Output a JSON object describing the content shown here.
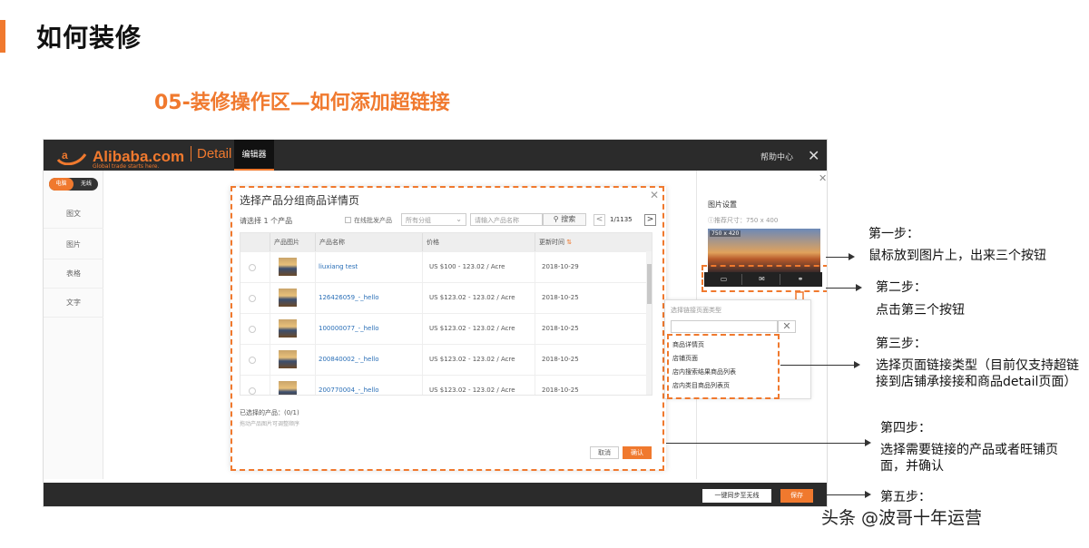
{
  "slide": {
    "title": "如何装修",
    "subtitle": "05-装修操作区—如何添加超链接"
  },
  "app": {
    "logo_text": "Alibaba.com",
    "logo_tagline": "Global trade starts here.",
    "detail": "Detail",
    "editor_tab": "编辑器",
    "help": "帮助中心",
    "close": "✕",
    "toggle": {
      "on": "电脑",
      "off": "无线"
    },
    "nav": [
      "图文",
      "图片",
      "表格",
      "文字"
    ]
  },
  "modal": {
    "title": "选择产品分组商品详情页",
    "close": "✕",
    "select_count": "请选择 1 个产品",
    "batch_label": "在线批发产品",
    "group_select": "所有分组",
    "search_placeholder": "请输入产品名称",
    "search_button": "搜索",
    "prev": "<",
    "next": ">",
    "page_text": "1/1135",
    "columns": [
      "产品图片",
      "产品名称",
      "价格",
      "更新时间"
    ],
    "rows": [
      {
        "name": "liuxiang test",
        "price": "US $100 - 123.02 / Acre",
        "date": "2018-10-29"
      },
      {
        "name": "126426059_-_hello",
        "price": "US $123.02 - 123.02 / Acre",
        "date": "2018-10-25"
      },
      {
        "name": "100000077_-_hello",
        "price": "US $123.02 - 123.02 / Acre",
        "date": "2018-10-25"
      },
      {
        "name": "200840002_-_hello",
        "price": "US $123.02 - 123.02 / Acre",
        "date": "2018-10-25"
      },
      {
        "name": "200770004_-_hello",
        "price": "US $123.02 - 123.02 / Acre",
        "date": "2018-10-25"
      }
    ],
    "picked": "已选择的产品：(0/1)",
    "pick_hint": "拖动产品图片可调整顺序",
    "cancel": "取消",
    "confirm": "确认"
  },
  "right_panel": {
    "close": "✕",
    "title": "图片设置",
    "size_hint": "ⓘ推荐尺寸：750 x 400",
    "image_label": "750 x 420",
    "icons": [
      "folder-icon",
      "image-icon",
      "link-icon"
    ]
  },
  "link_popup": {
    "title": "选择链接页面类型",
    "clear": "✕",
    "items": [
      "商品详情页",
      "店铺页面",
      "店内搜索结果商品列表",
      "店内类目商品列表页"
    ]
  },
  "bottom": {
    "sync": "一键同步至无线",
    "save": "保存"
  },
  "steps": [
    {
      "title": "第一步：",
      "body": "鼠标放到图片上，出来三个按钮"
    },
    {
      "title": "第二步：",
      "body": "点击第三个按钮"
    },
    {
      "title": "第三步：",
      "body": "选择页面链接类型（目前仅支持超链接到店铺承接接和商品detail页面）"
    },
    {
      "title": "第四步：",
      "body": "选择需要链接的产品或者旺铺页面，并确认"
    },
    {
      "title": "第五步：",
      "body": ""
    }
  ],
  "watermark": "头条 @波哥十年运营",
  "colors": {
    "accent": "#f0792e",
    "dark_bar": "#2b2b2b",
    "link": "#2a6fb7"
  }
}
